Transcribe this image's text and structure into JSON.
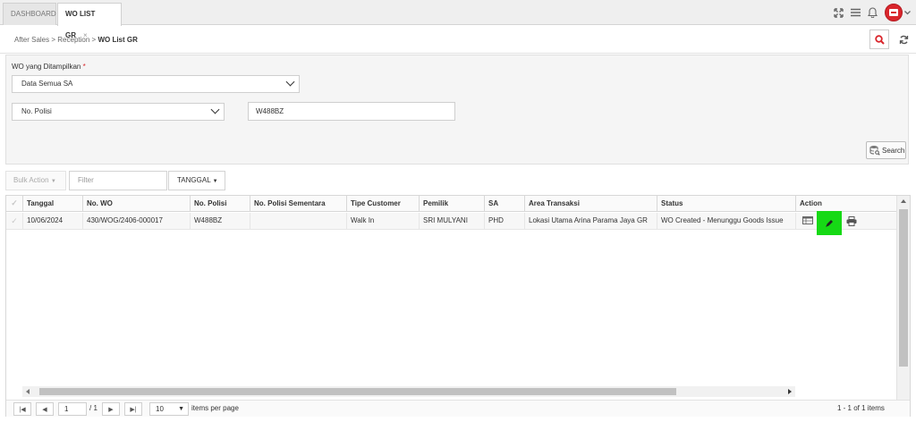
{
  "tabs": [
    {
      "label": "DASHBOARD"
    },
    {
      "label": "WO LIST GR",
      "close": "×"
    }
  ],
  "topbar": {
    "icons": [
      "fullscreen-icon",
      "hamburger-menu-icon",
      "bell-icon",
      "user-avatar"
    ]
  },
  "breadcrumb": {
    "items": [
      "After Sales",
      "Reception"
    ],
    "separator": ">",
    "current": "WO List GR"
  },
  "form": {
    "wo_label": "WO yang Ditampilkan",
    "required_mark": "*",
    "wo_select": "Data Semua SA",
    "criteria_select": "No. Polisi",
    "criteria_value": "W488BZ",
    "search_label": "Search"
  },
  "toolbar": {
    "bulk_action": "Bulk Action",
    "filter_placeholder": "Filter",
    "date_filter": "TANGGAL"
  },
  "table": {
    "columns": [
      "Tanggal",
      "No. WO",
      "No. Polisi",
      "No. Polisi Sementara",
      "Tipe Customer",
      "Pemilik",
      "SA",
      "Area Transaksi",
      "Status",
      "Action"
    ],
    "rows": [
      {
        "tanggal": "10/06/2024",
        "no_wo": "430/WOG/2406-000017",
        "no_polisi": "W488BZ",
        "no_polisi_sementara": "",
        "tipe_customer": "Walk In",
        "pemilik": "SRI MULYANI",
        "sa": "PHD",
        "area": "Lokasi Utama Arina Parama Jaya GR",
        "status": "WO Created - Menunggu Goods Issue"
      }
    ]
  },
  "pager": {
    "page": "1",
    "of_pages": "/ 1",
    "page_size": "10",
    "page_size_label": "items per page",
    "summary": "1 - 1 of 1 items"
  },
  "colors": {
    "accent": "#d9262c",
    "edit_highlight": "#16d915"
  }
}
